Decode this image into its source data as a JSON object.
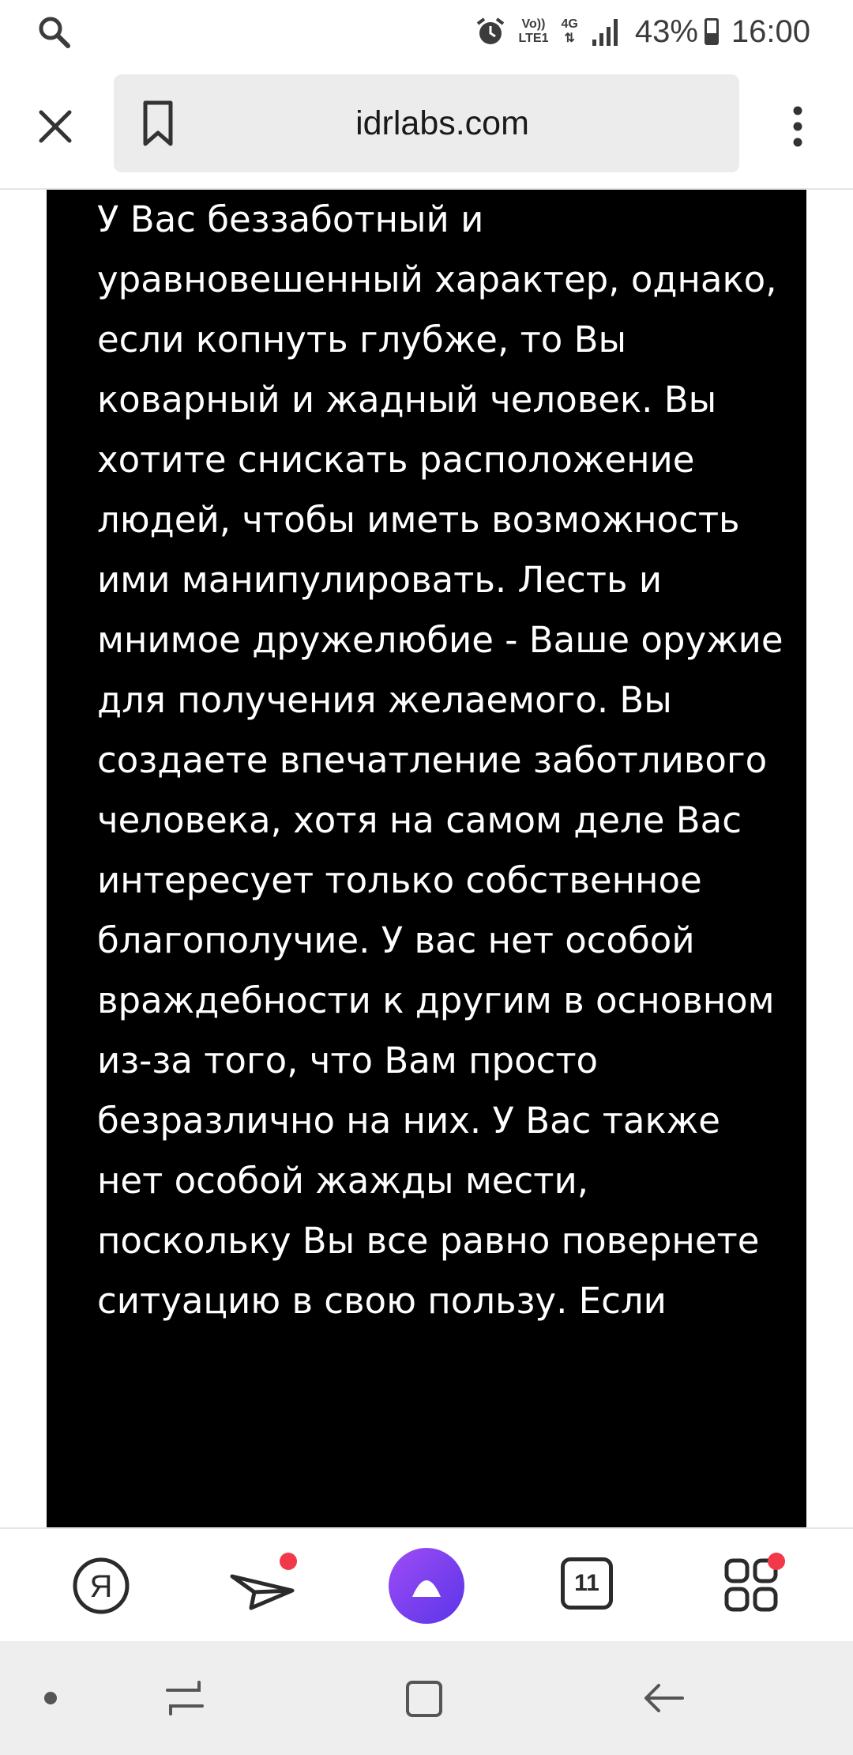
{
  "status_bar": {
    "left_icon": "search-icon",
    "alarm_icon": "alarm-icon",
    "network_top": "Vo))",
    "network_bottom": "LTE1",
    "net_type": "4G",
    "signal_icon": "signal-bars-icon",
    "battery_percent": "43%",
    "battery_level": 0.43,
    "time": "16:00"
  },
  "toolbar": {
    "close_icon": "close-icon",
    "bookmark_icon": "bookmark-icon",
    "url": "idrlabs.com",
    "menu_icon": "more-vertical-icon"
  },
  "article": {
    "text": "У Вас беззаботный и уравновешенный характер, однако, если копнуть глубже, то Вы коварный и жадный человек. Вы хотите снискать расположение людей, чтобы иметь возможность ими манипулировать. Лесть и мнимое дружелюбие - Ваше оружие для получения желаемого. Вы создаете впечатление заботливого человека, хотя на самом деле Вас интересует только собственное благополучие. У вас нет особой враждебности к другим в основном из-за того, что Вам просто безразлично на них. У Вас также нет особой жажды мести, поскольку Вы все равно повернете ситуацию в свою пользу. Если"
  },
  "bottom_nav": {
    "items": [
      {
        "icon": "yandex-logo-icon",
        "badge": false
      },
      {
        "icon": "paper-plane-icon",
        "badge": true
      },
      {
        "icon": "alice-assistant-icon",
        "badge": false
      },
      {
        "icon": "tabs-icon",
        "tab_count": "11",
        "badge": false
      },
      {
        "icon": "services-grid-icon",
        "badge": true
      }
    ],
    "accent_color": "#7b3ff2",
    "badge_color": "#f2394a"
  },
  "system_nav": {
    "items": [
      "dot-icon",
      "recent-apps-icon",
      "home-icon",
      "back-icon"
    ]
  }
}
